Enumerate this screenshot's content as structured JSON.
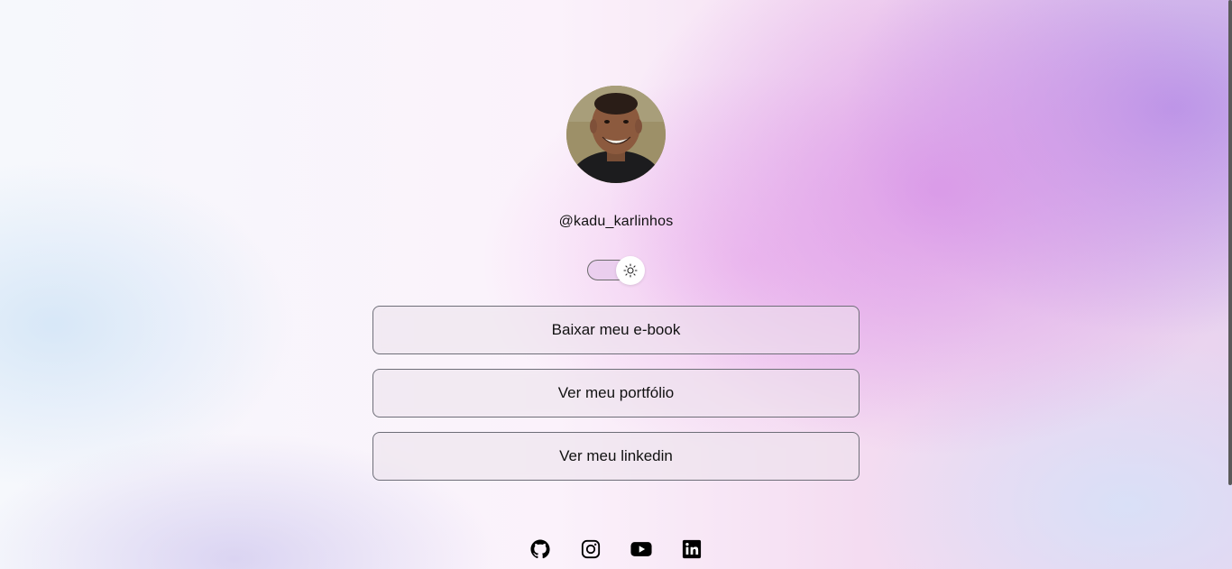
{
  "profile": {
    "handle": "@kadu_karlinhos",
    "avatar_icon": "profile-photo"
  },
  "theme_toggle": {
    "icon": "sun-icon",
    "state": "light"
  },
  "links": [
    {
      "label": "Baixar meu e-book"
    },
    {
      "label": "Ver meu portfólio"
    },
    {
      "label": "Ver meu linkedin"
    }
  ],
  "social": [
    {
      "icon": "github-icon"
    },
    {
      "icon": "instagram-icon"
    },
    {
      "icon": "youtube-icon"
    },
    {
      "icon": "linkedin-icon"
    }
  ],
  "colors": {
    "button_border": "#6e6e78",
    "text": "#111111",
    "accent_purple": "#b28ee6",
    "accent_pink": "#e6a8e8"
  }
}
